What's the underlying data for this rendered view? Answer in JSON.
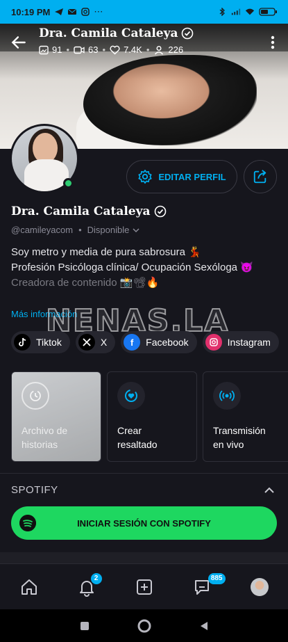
{
  "status": {
    "time": "10:19 PM",
    "extra": "⋯"
  },
  "header": {
    "title": "Dra. Camila Cataleya",
    "stats": {
      "photos": "91",
      "videos": "63",
      "likes": "7.4K",
      "fans": "226"
    }
  },
  "profile": {
    "name": "Dra. Camila Cataleya",
    "handle": "@camileyacom",
    "availability": "Disponible",
    "edit_button": "EDITAR PERFIL",
    "bio": {
      "line1": "Soy metro y media de pura sabrosura 💃",
      "line2": "Profesión Psicóloga clínica/ Ocupación Sexóloga 😈",
      "line3": "Creadora de contenido 📸📽🔥"
    },
    "more_info": "Más información",
    "watermark": "NENAS.LA"
  },
  "socials": [
    {
      "label": "Tiktok",
      "icon": "tiktok-icon",
      "color": "#000000"
    },
    {
      "label": "X",
      "icon": "x-icon",
      "color": "#000000"
    },
    {
      "label": "Facebook",
      "icon": "facebook-icon",
      "color": "#1877f2"
    },
    {
      "label": "Instagram",
      "icon": "instagram-icon",
      "color": "#e1306c"
    }
  ],
  "cards": [
    {
      "label_line1": "Archivo de",
      "label_line2": "historias"
    },
    {
      "label_line1": "Crear",
      "label_line2": "resaltado"
    },
    {
      "label_line1": "Transmisión",
      "label_line2": "en vivo"
    }
  ],
  "spotify": {
    "title": "SPOTIFY",
    "button": "INICIAR SESIÓN CON SPOTIFY"
  },
  "tabbar": {
    "notifications_badge": "2",
    "messages_badge": "885"
  },
  "colors": {
    "accent": "#00aff0",
    "spotify": "#1ed760",
    "online": "#2ecc71"
  }
}
